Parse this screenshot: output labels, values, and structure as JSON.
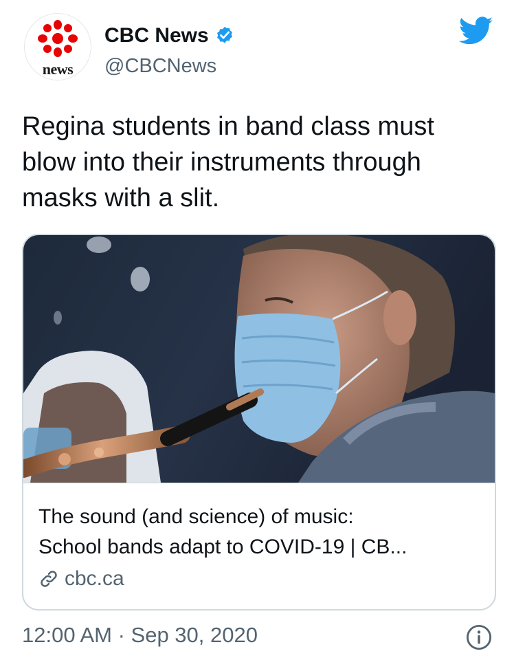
{
  "author": {
    "display_name": "CBC News",
    "handle": "@CBCNews",
    "avatar_wordmark": "news"
  },
  "tweet": {
    "lines": [
      "Regina students in band class must",
      "blow into their instruments through",
      "masks with a slit."
    ]
  },
  "card": {
    "title_lines": [
      "The sound (and science) of music:",
      "School bands adapt to COVID-19 | CB..."
    ],
    "domain": "cbc.ca"
  },
  "footer": {
    "timestamp": "12:00 AM · Sep 30, 2020"
  },
  "icons": {
    "logo": "cbc-gem-icon",
    "verified": "verified-badge-icon",
    "platform": "twitter-bird-icon",
    "link": "link-icon",
    "info": "info-icon"
  },
  "colors": {
    "cbc_red": "#e60505",
    "verified_blue": "#1d9bf0",
    "twitter_blue": "#1d9bf0",
    "secondary_text": "#536471"
  }
}
